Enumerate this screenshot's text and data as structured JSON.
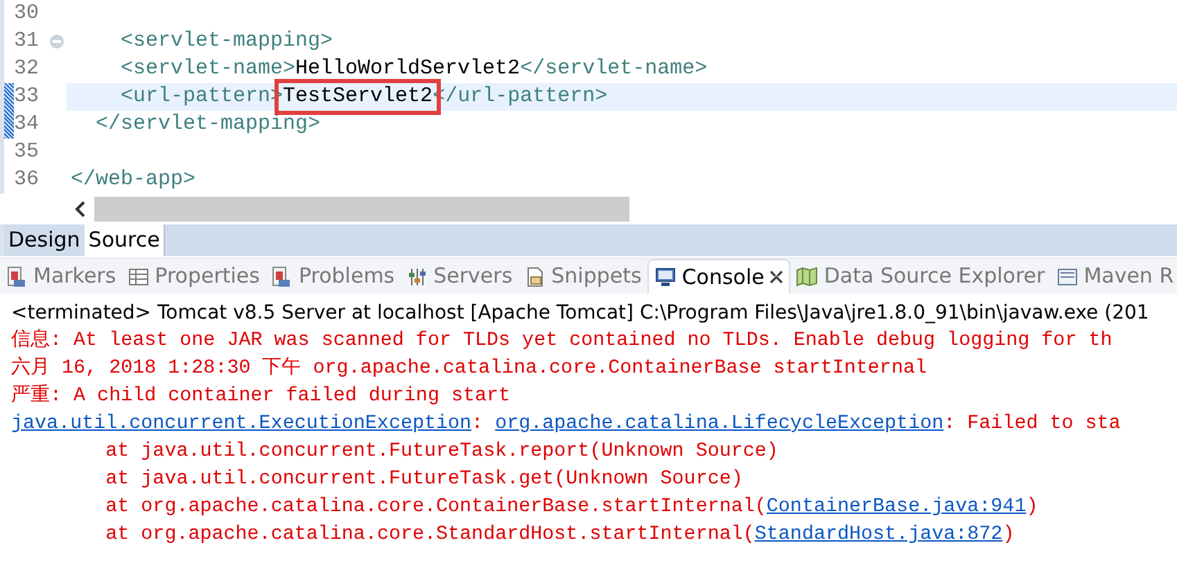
{
  "editor": {
    "lines": [
      {
        "number": "30",
        "current": false,
        "changed": false,
        "foldable": false
      },
      {
        "number": "31",
        "current": false,
        "changed": false,
        "foldable": true,
        "segments": [
          {
            "text": "    <servlet-mapping>",
            "kind": "tag",
            "boxed": false
          }
        ]
      },
      {
        "number": "32",
        "current": false,
        "changed": false,
        "foldable": false,
        "segments": [
          {
            "text": "    <servlet-name>",
            "kind": "tag",
            "boxed": false
          },
          {
            "text": "HelloWorldServlet2",
            "kind": "text",
            "boxed": false
          },
          {
            "text": "</servlet-name>",
            "kind": "tag",
            "boxed": false
          }
        ]
      },
      {
        "number": "33",
        "current": true,
        "changed": true,
        "foldable": false,
        "segments": [
          {
            "text": "    <url-pattern>",
            "kind": "tag",
            "boxed": false
          },
          {
            "text": "TestServlet2",
            "kind": "text",
            "boxed": true
          },
          {
            "text": "</url-pattern>",
            "kind": "tag",
            "boxed": false
          }
        ]
      },
      {
        "number": "34",
        "current": false,
        "changed": true,
        "foldable": false,
        "segments": [
          {
            "text": "  </servlet-mapping>",
            "kind": "tag",
            "boxed": false
          }
        ]
      },
      {
        "number": "35",
        "current": false,
        "changed": false,
        "foldable": false
      },
      {
        "number": "36",
        "current": false,
        "changed": false,
        "foldable": false,
        "segments": [
          {
            "text": "</web-app>",
            "kind": "tag",
            "boxed": false
          }
        ]
      }
    ]
  },
  "editor_tabs": [
    {
      "label": "Design",
      "selected": false
    },
    {
      "label": "Source",
      "selected": true
    }
  ],
  "view_tabs": [
    {
      "label": "Markers",
      "selected": false,
      "closable": false
    },
    {
      "label": "Properties",
      "selected": false,
      "closable": false
    },
    {
      "label": "Problems",
      "selected": false,
      "closable": false
    },
    {
      "label": "Servers",
      "selected": false,
      "closable": false
    },
    {
      "label": "Snippets",
      "selected": false,
      "closable": false
    },
    {
      "label": "Console",
      "selected": true,
      "closable": true
    },
    {
      "label": "Data Source Explorer",
      "selected": false,
      "closable": false
    },
    {
      "label": "Maven R",
      "selected": false,
      "closable": false
    }
  ],
  "console": {
    "header": "<terminated> Tomcat v8.5 Server at localhost [Apache Tomcat] C:\\Program Files\\Java\\jre1.8.0_91\\bin\\javaw.exe (201",
    "lines": [
      [
        {
          "text": "信息: At least one JAR was scanned for TLDs yet contained no TLDs. Enable debug logging for th",
          "kind": "error"
        }
      ],
      [
        {
          "text": "六月 16, 2018 1:28:30 下午 org.apache.catalina.core.ContainerBase startInternal",
          "kind": "error"
        }
      ],
      [
        {
          "text": "严重: A child container failed during start",
          "kind": "error"
        }
      ],
      [
        {
          "text": "java.util.concurrent.ExecutionException",
          "kind": "link"
        },
        {
          "text": ": ",
          "kind": "error"
        },
        {
          "text": "org.apache.catalina.LifecycleException",
          "kind": "link"
        },
        {
          "text": ": Failed to sta",
          "kind": "error"
        }
      ],
      [
        {
          "text": "\tat java.util.concurrent.FutureTask.report(Unknown Source)",
          "kind": "error"
        }
      ],
      [
        {
          "text": "\tat java.util.concurrent.FutureTask.get(Unknown Source)",
          "kind": "error"
        }
      ],
      [
        {
          "text": "\tat org.apache.catalina.core.ContainerBase.startInternal(",
          "kind": "error"
        },
        {
          "text": "ContainerBase.java:941",
          "kind": "link"
        },
        {
          "text": ")",
          "kind": "error"
        }
      ],
      [
        {
          "text": "\tat org.apache.catalina.core.StandardHost.startInternal(",
          "kind": "error"
        },
        {
          "text": "StandardHost.java:872",
          "kind": "link"
        },
        {
          "text": ")",
          "kind": "error"
        }
      ]
    ]
  }
}
